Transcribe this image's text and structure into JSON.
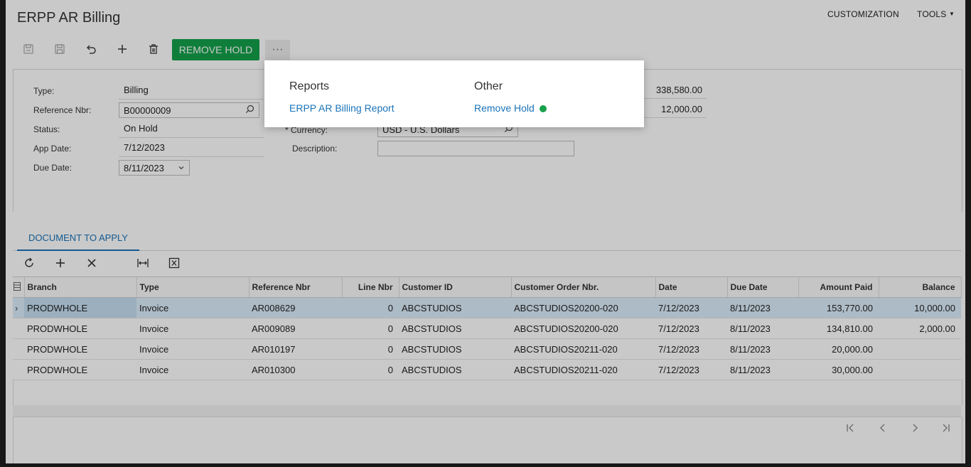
{
  "header": {
    "title": "ERPP AR Billing",
    "menu": [
      "CUSTOMIZATION",
      "TOOLS"
    ]
  },
  "toolbar": {
    "remove_hold_label": "REMOVE HOLD",
    "more_label": "···"
  },
  "form": {
    "type_label": "Type:",
    "type_value": "Billing",
    "refnbr_label": "Reference Nbr:",
    "refnbr_value": "B00000009",
    "status_label": "Status:",
    "status_value": "On Hold",
    "appdate_label": "App Date:",
    "appdate_value": "7/12/2023",
    "duedate_label": "Due Date:",
    "duedate_value": "8/11/2023",
    "currency_label": "* Currency:",
    "currency_value": "USD - U.S. Dollars",
    "description_label": "Description:",
    "description_value": "",
    "total1": "338,580.00",
    "total2": "12,000.00"
  },
  "tabs": [
    "DOCUMENT TO APPLY"
  ],
  "grid": {
    "columns": [
      "Branch",
      "Type",
      "Reference Nbr",
      "Line Nbr",
      "Customer ID",
      "Customer Order Nbr.",
      "Date",
      "Due Date",
      "Amount Paid",
      "Balance"
    ],
    "rows": [
      [
        "PRODWHOLE",
        "Invoice",
        "AR008629",
        "0",
        "ABCSTUDIOS",
        "ABCSTUDIOS20200-020",
        "7/12/2023",
        "8/11/2023",
        "153,770.00",
        "10,000.00"
      ],
      [
        "PRODWHOLE",
        "Invoice",
        "AR009089",
        "0",
        "ABCSTUDIOS",
        "ABCSTUDIOS20200-020",
        "7/12/2023",
        "8/11/2023",
        "134,810.00",
        "2,000.00"
      ],
      [
        "PRODWHOLE",
        "Invoice",
        "AR010197",
        "0",
        "ABCSTUDIOS",
        "ABCSTUDIOS20211-020",
        "7/12/2023",
        "8/11/2023",
        "20,000.00",
        ""
      ],
      [
        "PRODWHOLE",
        "Invoice",
        "AR010300",
        "0",
        "ABCSTUDIOS",
        "ABCSTUDIOS20211-020",
        "7/12/2023",
        "8/11/2023",
        "30,000.00",
        ""
      ]
    ]
  },
  "popup": {
    "reports_heading": "Reports",
    "reports_link": "ERPP AR Billing Report",
    "other_heading": "Other",
    "other_link": "Remove Hold",
    "status_dot_color": "#19a14b"
  }
}
